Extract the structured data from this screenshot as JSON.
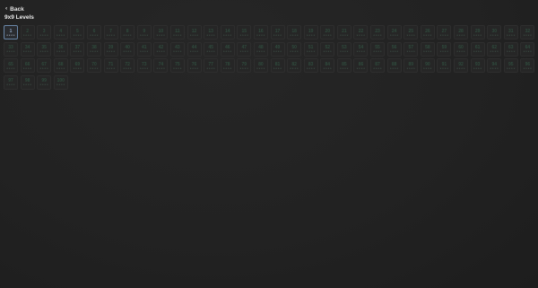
{
  "nav": {
    "back_label": "Back",
    "back_icon": "chevron-left-icon"
  },
  "page": {
    "title": "9x9 Levels"
  },
  "levels": {
    "current": 1,
    "stars_per_level": 4,
    "star_glyph": "★",
    "colors": {
      "active_border": "#6a87a8",
      "locked_number": "#2f4b3d",
      "tile_bg": "#262626"
    },
    "items": [
      {
        "number": "1",
        "active": true
      },
      {
        "number": "2"
      },
      {
        "number": "3"
      },
      {
        "number": "4"
      },
      {
        "number": "5"
      },
      {
        "number": "6"
      },
      {
        "number": "7"
      },
      {
        "number": "8"
      },
      {
        "number": "9"
      },
      {
        "number": "10"
      },
      {
        "number": "11"
      },
      {
        "number": "12"
      },
      {
        "number": "13"
      },
      {
        "number": "14"
      },
      {
        "number": "15"
      },
      {
        "number": "16"
      },
      {
        "number": "17"
      },
      {
        "number": "18"
      },
      {
        "number": "19"
      },
      {
        "number": "20"
      },
      {
        "number": "21"
      },
      {
        "number": "22"
      },
      {
        "number": "23"
      },
      {
        "number": "24"
      },
      {
        "number": "25"
      },
      {
        "number": "26"
      },
      {
        "number": "27"
      },
      {
        "number": "28"
      },
      {
        "number": "29"
      },
      {
        "number": "30"
      },
      {
        "number": "31"
      },
      {
        "number": "32"
      },
      {
        "number": "33"
      },
      {
        "number": "34"
      },
      {
        "number": "35"
      },
      {
        "number": "36"
      },
      {
        "number": "37"
      },
      {
        "number": "38"
      },
      {
        "number": "39"
      },
      {
        "number": "40"
      },
      {
        "number": "41"
      },
      {
        "number": "42"
      },
      {
        "number": "43"
      },
      {
        "number": "44"
      },
      {
        "number": "45"
      },
      {
        "number": "46"
      },
      {
        "number": "47"
      },
      {
        "number": "48"
      },
      {
        "number": "49"
      },
      {
        "number": "50"
      },
      {
        "number": "51"
      },
      {
        "number": "52"
      },
      {
        "number": "53"
      },
      {
        "number": "54"
      },
      {
        "number": "55"
      },
      {
        "number": "56"
      },
      {
        "number": "57"
      },
      {
        "number": "58"
      },
      {
        "number": "59"
      },
      {
        "number": "60"
      },
      {
        "number": "61"
      },
      {
        "number": "62"
      },
      {
        "number": "63"
      },
      {
        "number": "64"
      },
      {
        "number": "65"
      },
      {
        "number": "66"
      },
      {
        "number": "67"
      },
      {
        "number": "68"
      },
      {
        "number": "69"
      },
      {
        "number": "70"
      },
      {
        "number": "71"
      },
      {
        "number": "72"
      },
      {
        "number": "73"
      },
      {
        "number": "74"
      },
      {
        "number": "75"
      },
      {
        "number": "76"
      },
      {
        "number": "77"
      },
      {
        "number": "78"
      },
      {
        "number": "79"
      },
      {
        "number": "80"
      },
      {
        "number": "81"
      },
      {
        "number": "82"
      },
      {
        "number": "83"
      },
      {
        "number": "84"
      },
      {
        "number": "85"
      },
      {
        "number": "86"
      },
      {
        "number": "87"
      },
      {
        "number": "88"
      },
      {
        "number": "89"
      },
      {
        "number": "90"
      },
      {
        "number": "91"
      },
      {
        "number": "92"
      },
      {
        "number": "93"
      },
      {
        "number": "94"
      },
      {
        "number": "95"
      },
      {
        "number": "96"
      },
      {
        "number": "97"
      },
      {
        "number": "98"
      },
      {
        "number": "99"
      },
      {
        "number": "100"
      }
    ]
  }
}
